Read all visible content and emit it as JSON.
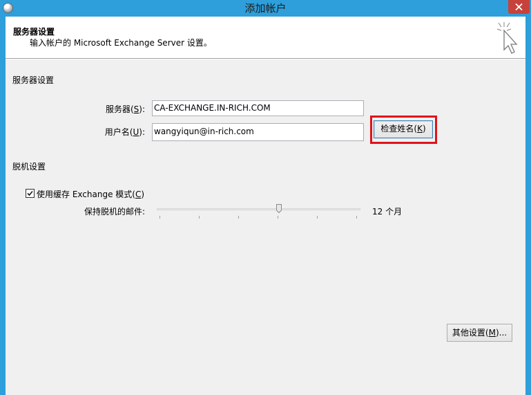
{
  "window": {
    "title": "添加帐户"
  },
  "header": {
    "title": "服务器设置",
    "subtitle": "输入帐户的 Microsoft Exchange Server 设置。"
  },
  "server_section": {
    "title": "服务器设置",
    "server_label": "服务器(",
    "server_hotkey": "S",
    "server_label_end": "):",
    "server_value": "CA-EXCHANGE.IN-RICH.COM",
    "username_label": "用户名(",
    "username_hotkey": "U",
    "username_label_end": "):",
    "username_value": "wangyiqun@in-rich.com",
    "check_name_label": "检查姓名(",
    "check_name_hotkey": "K",
    "check_name_label_end": ")"
  },
  "offline_section": {
    "title": "脱机设置",
    "cached_mode_label": "使用缓存 Exchange 模式(",
    "cached_mode_hotkey": "C",
    "cached_mode_label_end": ")",
    "cached_mode_checked": true,
    "keep_mail_label": "保持脱机的邮件:",
    "keep_mail_value": "12 个月",
    "keep_mail_slider_position": 0.6
  },
  "footer": {
    "more_settings_label": "其他设置(",
    "more_settings_hotkey": "M",
    "more_settings_label_end": ")..."
  },
  "colors": {
    "titlebar": "#2e9fda",
    "close_button": "#c7423b",
    "highlight": "#e0121a"
  }
}
